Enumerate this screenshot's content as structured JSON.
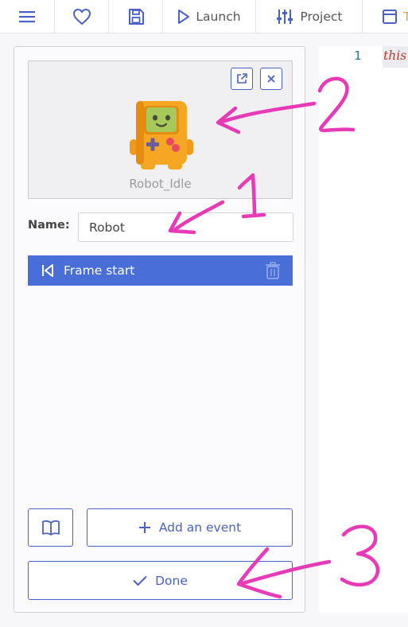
{
  "toolbar": {
    "launch_label": "Launch",
    "project_label": "Project",
    "truncated_label": "T"
  },
  "object_panel": {
    "sprite_name": "Robot_Idle",
    "name_label": "Name:",
    "name_value": "Robot",
    "event_label": "Frame start",
    "add_event_label": "Add an event",
    "done_label": "Done"
  },
  "editor": {
    "line_number": "1",
    "code": "this"
  },
  "annotations": {
    "marks": [
      "1",
      "2",
      "3"
    ],
    "color": "#e83ab7"
  },
  "colors": {
    "accent": "#4a62c8",
    "event_row": "#4a6ed8"
  }
}
